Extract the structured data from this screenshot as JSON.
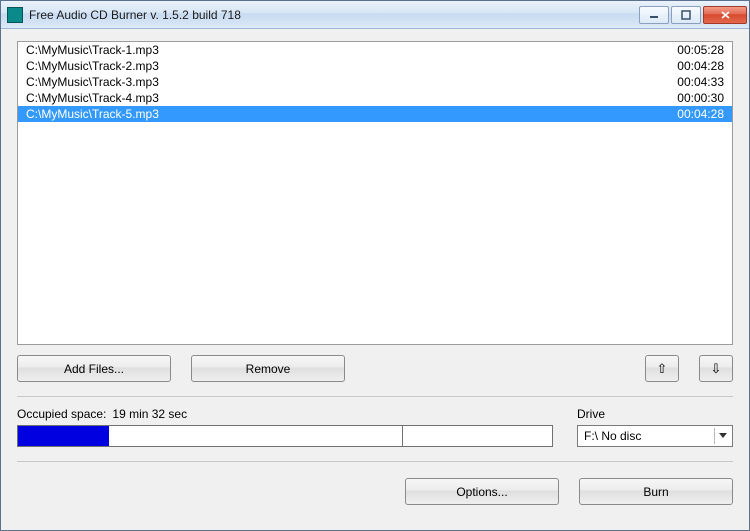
{
  "window": {
    "title": "Free Audio CD Burner  v. 1.5.2 build 718"
  },
  "tracks": [
    {
      "path": "C:\\MyMusic\\Track-1.mp3",
      "duration": "00:05:28",
      "selected": false
    },
    {
      "path": "C:\\MyMusic\\Track-2.mp3",
      "duration": "00:04:28",
      "selected": false
    },
    {
      "path": "C:\\MyMusic\\Track-3.mp3",
      "duration": "00:04:33",
      "selected": false
    },
    {
      "path": "C:\\MyMusic\\Track-4.mp3",
      "duration": "00:00:30",
      "selected": false
    },
    {
      "path": "C:\\MyMusic\\Track-5.mp3",
      "duration": "00:04:28",
      "selected": true
    }
  ],
  "buttons": {
    "add_files": "Add Files...",
    "remove": "Remove",
    "options": "Options...",
    "burn": "Burn"
  },
  "occupied": {
    "label": "Occupied space:",
    "value": "19 min 32 sec",
    "fill_percent": 17,
    "tick_percent": 72
  },
  "drive": {
    "label": "Drive",
    "selected": "F:\\ No disc"
  }
}
